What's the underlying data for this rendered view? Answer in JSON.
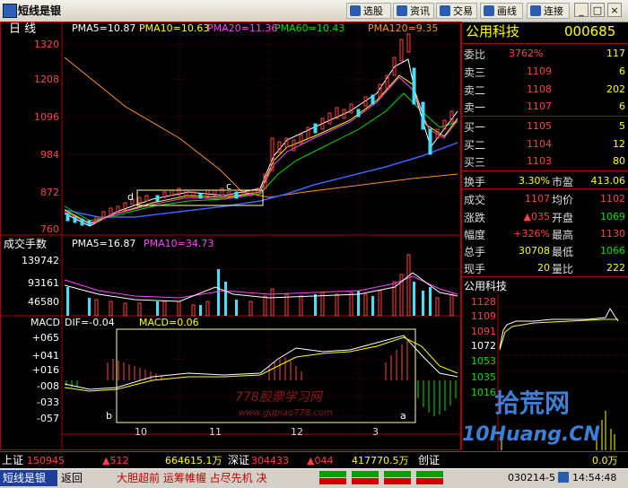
{
  "window": {
    "title": "短线是银"
  },
  "toolbar": {
    "buttons": [
      "选股",
      "资讯",
      "交易",
      "画线",
      "连接"
    ],
    "window_controls": [
      "_",
      "□",
      "×"
    ]
  },
  "price_chart": {
    "period_label": "日   线",
    "indicators": {
      "pma5": "PMA5=10.87",
      "pma10": "PMA10=10.63",
      "pma20": "PMA20=11.36",
      "pma60": "PMA60=10.43",
      "pma120": "PMA120=9.35"
    },
    "y_ticks": [
      "1320",
      "1208",
      "1096",
      "984",
      "872",
      "760"
    ],
    "annotations": {
      "c": "c",
      "d": "d"
    }
  },
  "volume_chart": {
    "title": "成交手数",
    "indicators": {
      "pma5": "PMA5=16.87",
      "pma10": "PMA10=34.73"
    },
    "y_ticks": [
      "139742",
      "93161",
      "46580"
    ]
  },
  "macd_chart": {
    "title": "MACD",
    "indicators": {
      "dif": "DIF=-0.04",
      "macd": "MACD=0.06"
    },
    "y_ticks": [
      "+065",
      "+041",
      "+016",
      "-008",
      "-033",
      "-057"
    ],
    "annotations": {
      "a": "a",
      "b": "b"
    },
    "x_ticks": [
      "10",
      "11",
      "12",
      "3"
    ],
    "watermark": "778股票学习网",
    "watermark_url": "www.gupiao778.com"
  },
  "stock": {
    "name": "公用科技",
    "code": "000685",
    "quote": [
      {
        "label": "委比",
        "value": "3762%",
        "value2": "117"
      },
      {
        "label": "卖三",
        "value": "1109",
        "value2": "6"
      },
      {
        "label": "卖二",
        "value": "1108",
        "value2": "202"
      },
      {
        "label": "卖一",
        "value": "1107",
        "value2": "6"
      },
      {
        "label": "买一",
        "value": "1105",
        "value2": "5"
      },
      {
        "label": "买二",
        "value": "1104",
        "value2": "12"
      },
      {
        "label": "买三",
        "value": "1103",
        "value2": "80"
      }
    ],
    "turnover": {
      "label": "换手",
      "value": "3.30%",
      "label2": "市盈",
      "value2": "413.06"
    },
    "stats": [
      {
        "label": "成交",
        "value": "1107",
        "label2": "均价",
        "value2": "1102"
      },
      {
        "label": "涨跌",
        "value": "▲035",
        "label2": "开盘",
        "value2": "1069"
      },
      {
        "label": "幅度",
        "value": "+326%",
        "label2": "最高",
        "value2": "1130"
      },
      {
        "label": "总手",
        "value": "30708",
        "label2": "最低",
        "value2": "1066"
      },
      {
        "label": "现手",
        "value": "20",
        "label2": "量比",
        "value2": "222"
      }
    ],
    "intraday": {
      "title": "公用科技",
      "y_ticks": [
        "1128",
        "1109",
        "1091",
        "1072",
        "1053",
        "1035",
        "1016"
      ]
    }
  },
  "status": {
    "sh_label": "上证",
    "sh_value": "150945",
    "sh_change": "▲512",
    "sh_amount": "664615.1万",
    "sz_label": "深证",
    "sz_value": "304433",
    "sz_change": "▲044",
    "sz_amount": "417770.5万",
    "cy_label": "创证",
    "cy_value": "0.0万"
  },
  "bottom": {
    "app": "短线是银",
    "back": "返回",
    "ticker": "大胆超前  运筹帷幄  占尽先机  决",
    "date": "030214-5",
    "time": "14:54:48"
  },
  "watermark2": {
    "text": "拾荒网",
    "url": "10Huang.CN"
  },
  "colors": {
    "grid_red": "#b00000",
    "price_up": "#ff4040",
    "price_down": "#40e0ff",
    "pma5": "#ffffff",
    "pma10": "#ffff00",
    "pma20": "#ff40ff",
    "pma60": "#00e000",
    "pma120": "#ff9020"
  }
}
